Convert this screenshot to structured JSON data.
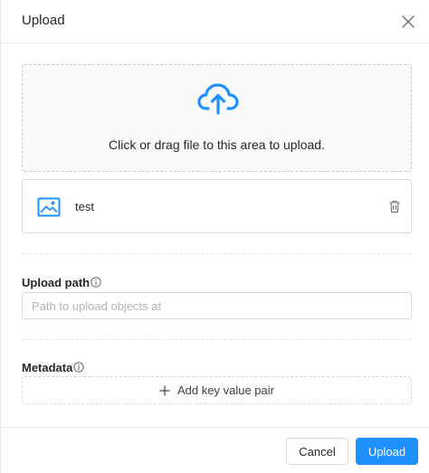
{
  "modal": {
    "title": "Upload"
  },
  "dropzone": {
    "text": "Click or drag file to this area to upload."
  },
  "files": [
    {
      "name": "test"
    }
  ],
  "upload_path": {
    "label": "Upload path",
    "placeholder": "Path to upload objects at",
    "value": ""
  },
  "metadata": {
    "label": "Metadata",
    "add_label": "Add key value pair"
  },
  "footer": {
    "cancel_label": "Cancel",
    "upload_label": "Upload"
  },
  "icons": {
    "close": "close-icon",
    "cloud_upload": "cloud-upload-icon",
    "file_thumbnail": "image-icon",
    "delete": "trash-icon",
    "info": "info-icon",
    "add": "plus-icon"
  },
  "colors": {
    "accent": "#1e90ff",
    "border": "#d9d9d9",
    "dropzone_bg": "#fafafa",
    "placeholder": "#b3b3b3"
  }
}
